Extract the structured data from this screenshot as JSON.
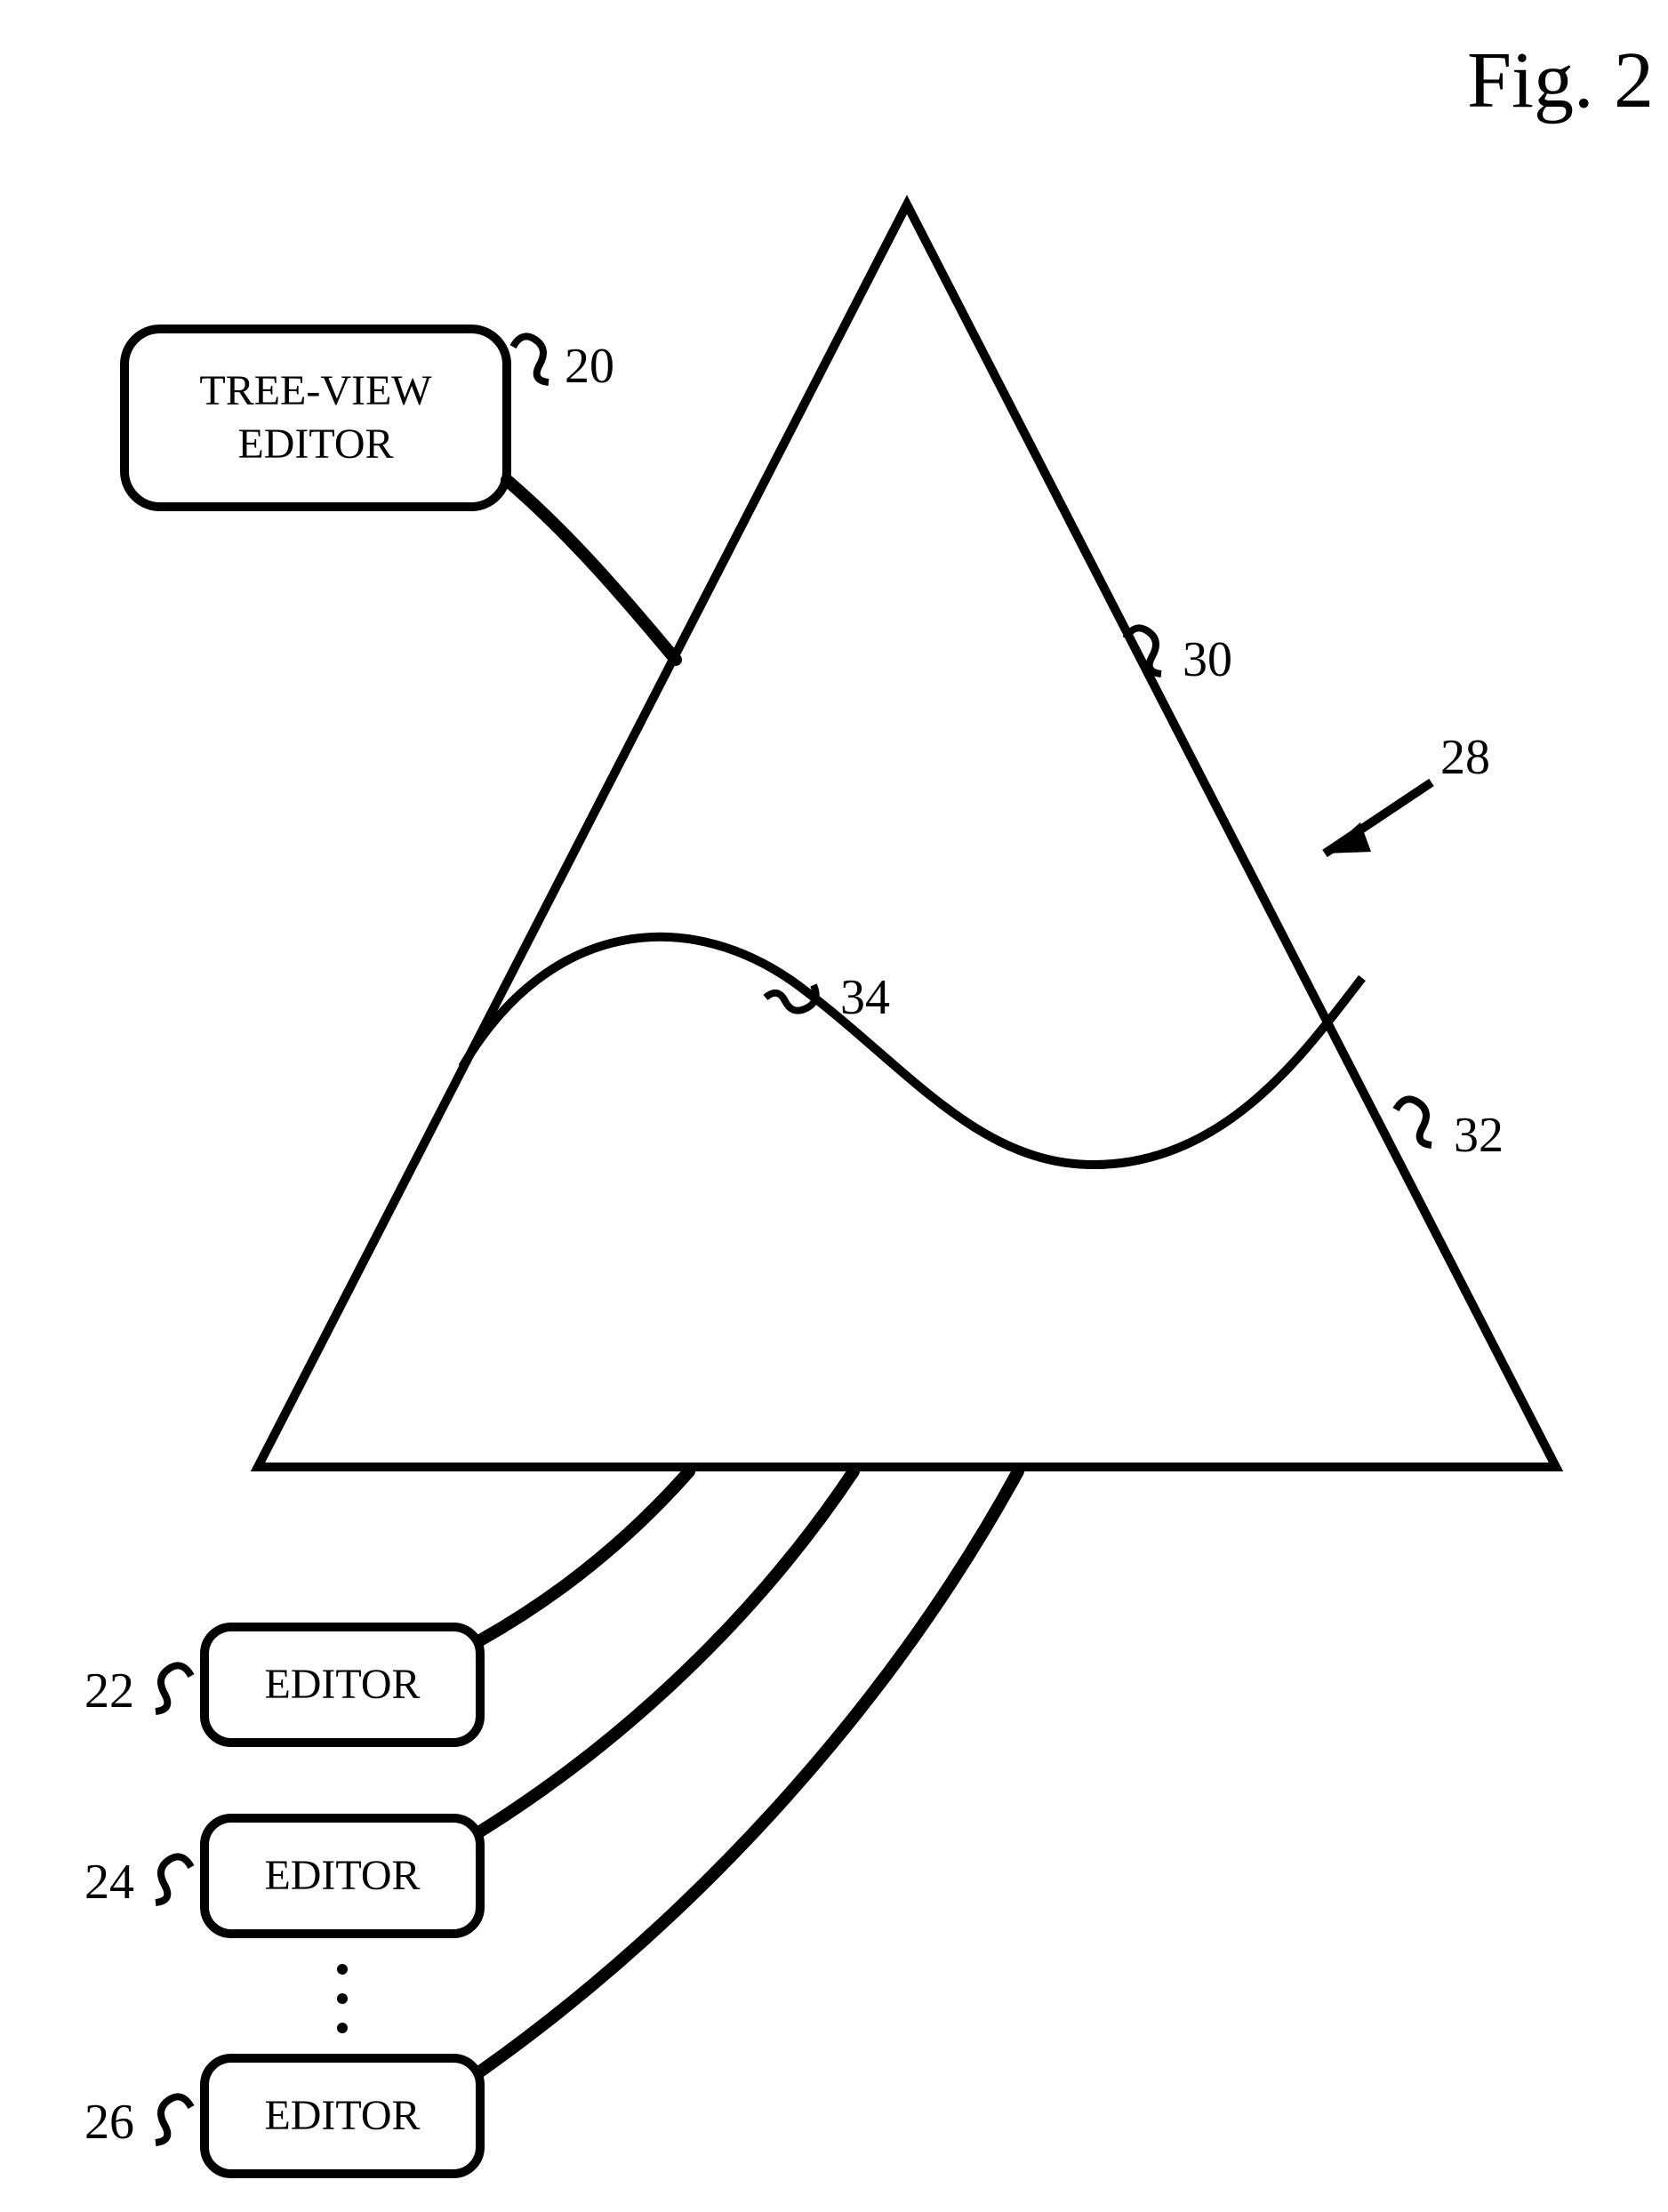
{
  "figure": {
    "title": "Fig. 2"
  },
  "boxes": {
    "treeView": {
      "line1": "TREE-VIEW",
      "line2": "EDITOR",
      "ref": "20"
    },
    "editor22": {
      "label": "EDITOR",
      "ref": "22"
    },
    "editor24": {
      "label": "EDITOR",
      "ref": "24"
    },
    "editor26": {
      "label": "EDITOR",
      "ref": "26"
    }
  },
  "refs": {
    "r28": "28",
    "r30": "30",
    "r32": "32",
    "r34": "34"
  }
}
